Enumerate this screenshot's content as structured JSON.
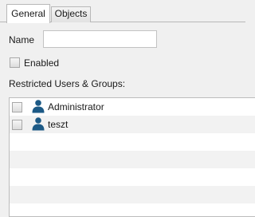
{
  "tabs": {
    "general": "General",
    "objects": "Objects"
  },
  "form": {
    "name_label": "Name",
    "name_value": "",
    "enabled_label": "Enabled",
    "enabled_checked": false,
    "restricted_label": "Restricted Users & Groups:"
  },
  "users": [
    {
      "name": "Administrator",
      "checked": false,
      "icon": "user-icon"
    },
    {
      "name": "teszt",
      "checked": false,
      "icon": "user-icon"
    }
  ]
}
